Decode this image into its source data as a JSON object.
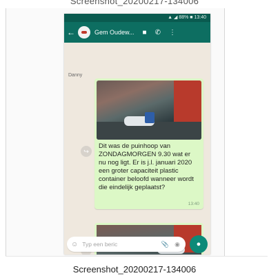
{
  "top_filename_cut": "Screenshot_20200217-134006",
  "phone": {
    "status_text": "▲ ◢ 88% ■ 13:40",
    "chat_title": "Gem Oudew...",
    "icons": {
      "back": "back-arrow-icon",
      "avatar": "avatar-icon",
      "video": "video-icon",
      "call": "phone-icon",
      "menu": "more-icon"
    }
  },
  "chat": {
    "sender_name": "Danny",
    "message_text": "Dit was de puinhoop van ZONDAGMORGEN 9.30 wat er nu nog ligt. Er is j.l. januari 2020 een groter capaciteit plastic container beloofd wanneer wordt die eindelijk geplaatst?",
    "message_time": "13:40",
    "input_placeholder": "Typ een beric",
    "share_icon": "share-icon"
  },
  "caption": "Screenshot_20200217-134006"
}
